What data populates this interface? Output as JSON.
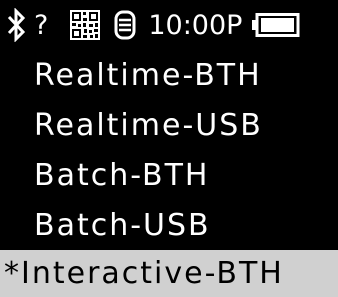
{
  "status_bar": {
    "bluetooth_icon": "bluetooth-icon",
    "unknown_indicator": "?",
    "qr_icon": "qr-code-icon",
    "device_icon": "sensor-device-icon",
    "time": "10:00P",
    "battery_icon": "battery-icon",
    "battery_level": 1.0
  },
  "menu": {
    "items": [
      {
        "label": "Realtime-BTH",
        "selected": false
      },
      {
        "label": "Realtime-USB",
        "selected": false
      },
      {
        "label": "Batch-BTH",
        "selected": false
      },
      {
        "label": "Batch-USB",
        "selected": false
      },
      {
        "label": "*Interactive-BTH",
        "selected": true
      }
    ]
  },
  "colors": {
    "background": "#000000",
    "foreground": "#ffffff",
    "selection": "#d0d0d0"
  }
}
